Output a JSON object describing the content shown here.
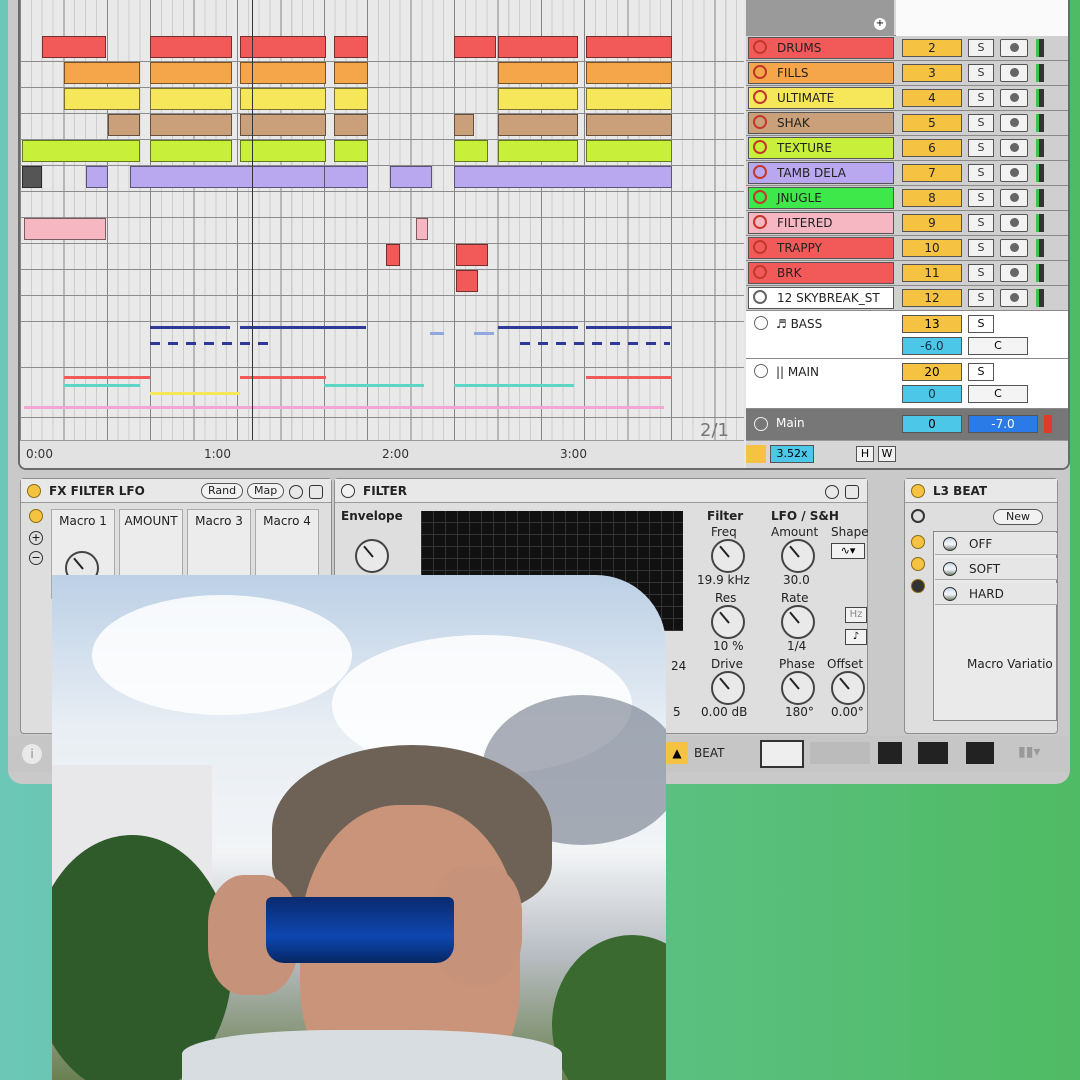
{
  "timeline": {
    "ticks": [
      "0:00",
      "1:00",
      "2:00",
      "3:00"
    ],
    "loop_counter": "2/1"
  },
  "tracks": [
    {
      "name": "DRUMS",
      "num": "2",
      "solo": "S",
      "color": "#f25a5a"
    },
    {
      "name": "FILLS",
      "num": "3",
      "solo": "S",
      "color": "#f5a64a"
    },
    {
      "name": "ULTIMATE",
      "num": "4",
      "solo": "S",
      "color": "#f6e65a"
    },
    {
      "name": "SHAK",
      "num": "5",
      "solo": "S",
      "color": "#c9a07a"
    },
    {
      "name": "TEXTURE",
      "num": "6",
      "solo": "S",
      "color": "#c8f03a"
    },
    {
      "name": "TAMB DELA",
      "num": "7",
      "solo": "S",
      "color": "#b9a8f0"
    },
    {
      "name": "JNUGLE",
      "num": "8",
      "solo": "S",
      "color": "#3ee84a"
    },
    {
      "name": "FILTERED",
      "num": "9",
      "solo": "S",
      "color": "#f6b6c2"
    },
    {
      "name": "TRAPPY",
      "num": "10",
      "solo": "S",
      "color": "#f25a5a"
    },
    {
      "name": "BRK",
      "num": "11",
      "solo": "S",
      "color": "#f25a5a"
    },
    {
      "name": "12 SKYBREAK_ST",
      "num": "12",
      "solo": "S",
      "color": "#ffffff"
    }
  ],
  "buses": [
    {
      "name": "♬ BASS",
      "num": "13",
      "solo": "S",
      "vol": "-6.0",
      "c": "C"
    },
    {
      "name": "|| MAIN",
      "num": "20",
      "solo": "S",
      "vol": "0",
      "c": "C"
    }
  ],
  "main": {
    "label": "Main",
    "vol": "0",
    "pan": "-7.0"
  },
  "transport": {
    "zoom": "3.52x",
    "h_label": "H",
    "w_label": "W"
  },
  "fx_filter_lfo": {
    "title": "FX FILTER LFO",
    "rand_label": "Rand",
    "map_label": "Map",
    "macros": [
      "Macro 1",
      "AMOUNT",
      "Macro 3",
      "Macro 4"
    ]
  },
  "filter": {
    "title": "FILTER",
    "envelope_label": "Envelope",
    "filter_label": "Filter",
    "freq_label": "Freq",
    "freq_value": "19.9 kHz",
    "res_label": "Res",
    "res_value": "10 %",
    "drive_label": "Drive",
    "drive_value": "0.00 dB",
    "lfo_title": "LFO / S&H",
    "amount_label": "Amount",
    "amount_value": "30.0",
    "shape_label": "Shape",
    "rate_label": "Rate",
    "rate_value": "1/4",
    "hz_label": "Hz",
    "phase_label": "Phase",
    "phase_value": "180°",
    "offset_label": "Offset",
    "offset_value": "0.00°",
    "partial_values": [
      "24",
      "5"
    ]
  },
  "l3_beat": {
    "title": "L3 BEAT",
    "new_label": "New",
    "presets": [
      "OFF",
      "SOFT",
      "HARD"
    ],
    "macro_variations_label": "Macro Variatio"
  },
  "status_bar": {
    "beat_label": "BEAT",
    "info_icon": "info-icon"
  },
  "colors": {
    "accent": "#f5c242",
    "cyan": "#4cc7e8",
    "green_bg": "#5ec28e"
  }
}
